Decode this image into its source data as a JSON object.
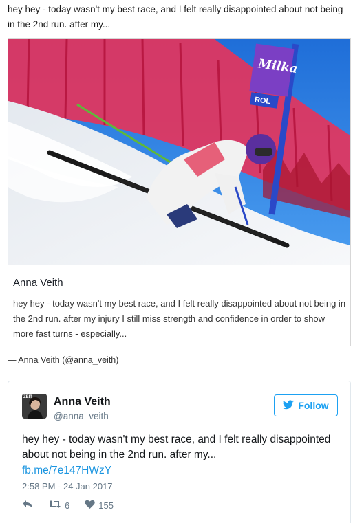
{
  "excerpt": {
    "text": "hey hey - today wasn't my best race, and I felt really disappointed about not being in the 2nd run. after my..."
  },
  "facebook_embed": {
    "title": "Anna Veith",
    "body": "hey hey - today wasn't my best race, and I felt really disappointed about not being in the 2nd run. after my injury I still miss strength and confidence in order to show more fast turns - especially...",
    "photo_banner_text": "Milka",
    "photo_sign_text": "ROL"
  },
  "attribution": "— Anna Veith (@anna_veith)",
  "tweet": {
    "avatar_badge": "ZEIT",
    "display_name": "Anna Veith",
    "screen_name": "@anna_veith",
    "follow_label": "Follow",
    "text": "hey hey - today wasn't my best race, and I felt really disappointed about not being in the 2nd run. after my...",
    "link": "fb.me/7e147HWzY",
    "timestamp": "2:58 PM - 24 Jan 2017",
    "retweet_count": "6",
    "like_count": "155"
  },
  "colors": {
    "twitter_blue": "#1da1f2",
    "link_blue": "#1b95e0",
    "fence_red": "#e8335a",
    "sky_blue": "#2f7fe0"
  }
}
